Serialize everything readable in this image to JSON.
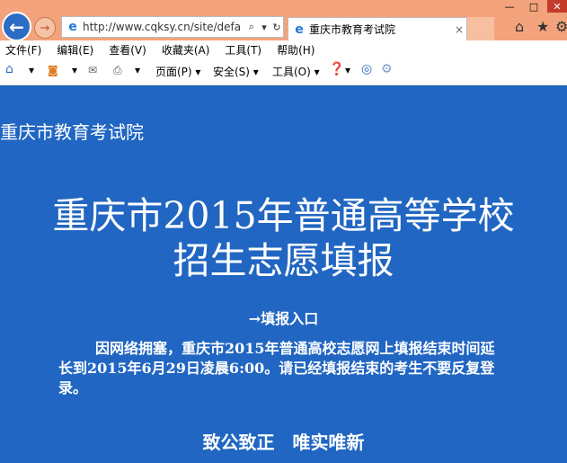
{
  "browser": {
    "address_url": "http://www.cqksy.cn/site/defa",
    "tab_title": "重庆市教育考试院",
    "tab_close": "×",
    "menu": [
      "文件(F)",
      "编辑(E)",
      "查看(V)",
      "收藏夹(A)",
      "工具(T)",
      "帮助(H)"
    ],
    "cmd": {
      "page": "页面(P) ▾",
      "safety": "安全(S) ▾",
      "tools": "工具(O) ▾"
    }
  },
  "page": {
    "site_title": "重庆市教育考试院",
    "headline_line1": "重庆市2015年普通高等学校",
    "headline_line2": "招生志愿填报",
    "entry_link": "→填报入口",
    "notice": "因网络拥塞，重庆市2015年普通高校志愿网上填报结束时间延长到2015年6月29日凌晨6:00。请已经填报结束的考生不要反复登录。",
    "motto": "致公致正　唯实唯新"
  }
}
